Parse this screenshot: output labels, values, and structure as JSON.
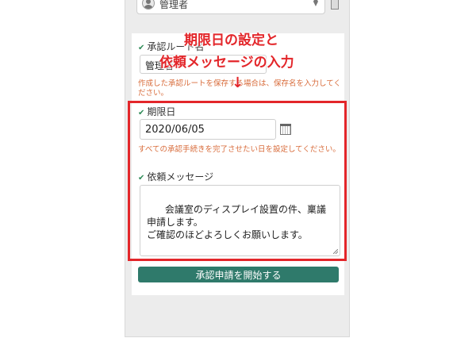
{
  "top": {
    "selected_value": "管理者"
  },
  "route_name": {
    "label": "承認ルート名",
    "value": "管理者",
    "help": "作成した承認ルートを保存する場合は、保存名を入力してください。"
  },
  "deadline": {
    "label": "期限日",
    "value": "2020/06/05",
    "help": "すべての承認手続きを完了させたい日を設定してください。"
  },
  "message": {
    "label": "依頼メッセージ",
    "value": "会議室のディスプレイ設置の件、稟議申請します。\nご確認のほどよろしくお願いします。"
  },
  "submit_label": "承認申請を開始する",
  "annotation": {
    "line1": "期限日の設定と",
    "line2": "依頼メッセージの入力",
    "arrow": "↓"
  },
  "colors": {
    "accent": "#2f7a6b",
    "annotation": "#e3262a",
    "help_text": "#d86b3a"
  }
}
